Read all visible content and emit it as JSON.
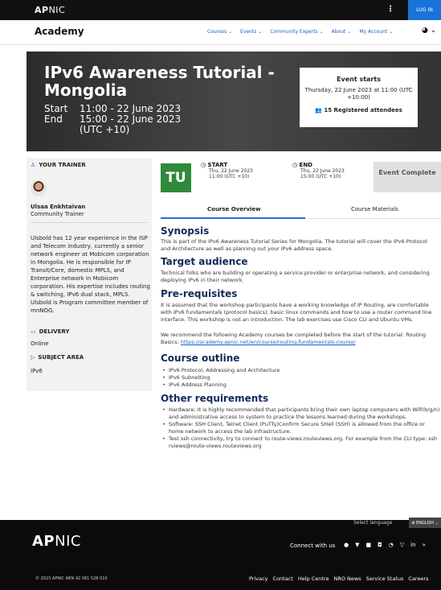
{
  "topbar": {
    "logo_bold": "AP",
    "logo_rest": "NIC",
    "menu_glyph": "⋮",
    "login": "LOG IN"
  },
  "nav": {
    "brand": "Academy",
    "items": [
      "Courses ⌄",
      "Events ⌄",
      "Community Experts ⌄",
      "About ⌄",
      "My Account ⌄"
    ],
    "icons": "◕ ⌄"
  },
  "hero": {
    "title": "IPv6 Awareness Tutorial - Mongolia",
    "start_label": "Start",
    "start_value": "11:00 - 22 June 2023",
    "end_label": "End",
    "end_value": "15:00 - 22 June 2023",
    "tz": "(UTC +10)",
    "card": {
      "heading": "Event starts",
      "date": "Thursday, 22 June 2023 at 11:00 (UTC +10:00)",
      "attendees": "15 Registered attendees"
    }
  },
  "sidebar": {
    "trainer_heading": "YOUR TRAINER",
    "trainer_name": "Ulsaa Enkhtaivan",
    "trainer_role": "Community Trainer",
    "bio": "Ulsbold has 12 year experience in the ISP and Telecom industry, currently a senior network engineer at Mobicom corporation in Mongolia. He is responsible for IP Transit/Core, domestic MPLS, and Enterprise network in Mobicom corporation. His expertise includes routing & switching, IPv6 dual stack, MPLS. Ulsbold is Program committee member of mnNOG.",
    "delivery_heading": "DELIVERY",
    "delivery_value": "Online",
    "subject_heading": "SUBJECT AREA",
    "subject_value": "IPv6"
  },
  "event": {
    "badge": "TU",
    "start_label": "START",
    "start_date": "Thu, 22 June 2023",
    "start_time": "11:00 (UTC +10)",
    "end_label": "END",
    "end_date": "Thu, 22 June 2023",
    "end_time": "15:00 (UTC +10)",
    "status": "Event Complete"
  },
  "tabs": [
    "Course Overview",
    "Course Materials"
  ],
  "content": {
    "synopsis_h": "Synopsis",
    "synopsis": "This is part of the IPv6 Awareness Tutorial Series for Mongolia. The tutorial will cover the IPv6 Protocol and Architecture as well as planning out your IPv6 address space.",
    "audience_h": "Target audience",
    "audience": "Technical folks who are building or operating a service provider or enterprise network, and considering deploying IPv6 in their network.",
    "prereq_h": "Pre-requisites",
    "prereq1": "It is assumed that the workshop participants have a working knowledge of IP Routing, are comfortable with IPv6 fundamentals (protocol basics), basic linux commands and how to use a router command line interface. This workshop is not an introduction. The lab exercises use Cisco CLI and Ubuntu VMs.",
    "prereq2": "We recommend the following Academy courses be completed before the start of the tutorial: Routing Basics:",
    "prereq_link": "https://academy.apnic.net/en/course/routing-fundamentals-course/",
    "outline_h": "Course outline",
    "outline": [
      "IPv6 Protocol, Addressing and Architecture",
      "IPv6 Subnetting",
      "IPv6 Address Planning"
    ],
    "other_h": "Other requirements",
    "other": [
      "Hardware: It is highly recommended that participants bring their own laptop computers with Wifi(b/g/n) and administrative access to system to practice the lessons learned during the workshops.",
      "Software: SSH Client, Telnet Client (PuTTy)Confirm Secure SHell (SSH) is allowed from the office or home network to access the lab infrastructure.",
      "Test ssh connectivity, try to connect to route-views.routeviews.org. For example from the CLI type: ssh rviews@route-views.routeviews.org"
    ]
  },
  "footer": {
    "select_language": "Select language",
    "language": "⊕ ENGLISH ⌄",
    "logo_bold": "AP",
    "logo_rest": "NIC",
    "connect": "Connect with us",
    "copyright": "© 2023 APNIC   ABN 42 081 528 010",
    "links": [
      "Privacy",
      "Contact",
      "Help Centre",
      "NRO News",
      "Service Status",
      "Careers"
    ]
  }
}
